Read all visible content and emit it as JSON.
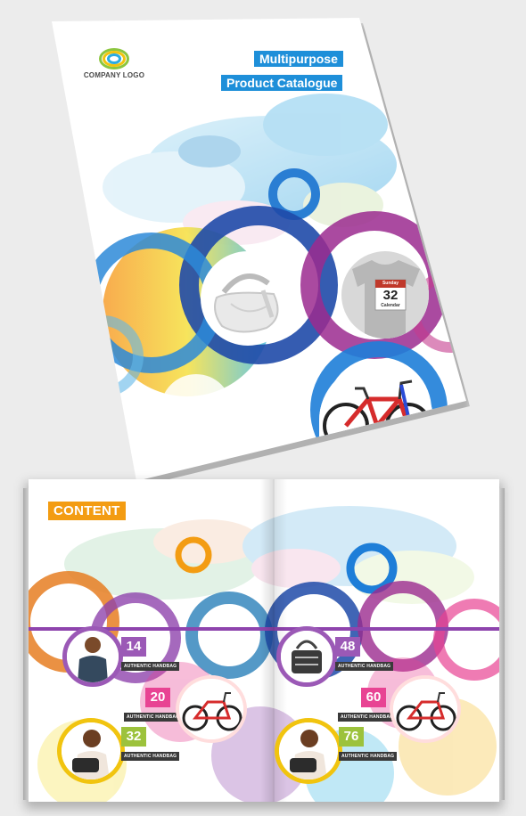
{
  "cover": {
    "logo_text": "COMPANY LOGO",
    "title_line1": "Multipurpose",
    "title_line2": "Product Catalogue",
    "calendar": {
      "day_name": "Sunday",
      "day_number": "32",
      "caption": "Calendar"
    }
  },
  "catalogue": {
    "section_title": "CONTENT",
    "items": [
      {
        "number": "14",
        "label": "AUTHENTIC HANDBAG",
        "color": "#9b59b6",
        "product": "person"
      },
      {
        "number": "20",
        "label": "AUTHENTIC HANDBAG",
        "color": "#e84393",
        "product": "bicycle"
      },
      {
        "number": "32",
        "label": "AUTHENTIC HANDBAG",
        "color": "#9cc23c",
        "product": "person"
      },
      {
        "number": "48",
        "label": "AUTHENTIC HANDBAG",
        "color": "#9b59b6",
        "product": "bag"
      },
      {
        "number": "60",
        "label": "AUTHENTIC HANDBAG",
        "color": "#e84393",
        "product": "bicycle"
      },
      {
        "number": "76",
        "label": "AUTHENTIC HANDBAG",
        "color": "#9cc23c",
        "product": "person"
      }
    ]
  },
  "colors": {
    "blue": "#1e8fd9",
    "purple": "#8e44ad",
    "pink": "#e84393",
    "orange": "#f39c12",
    "green": "#9cc23c"
  }
}
